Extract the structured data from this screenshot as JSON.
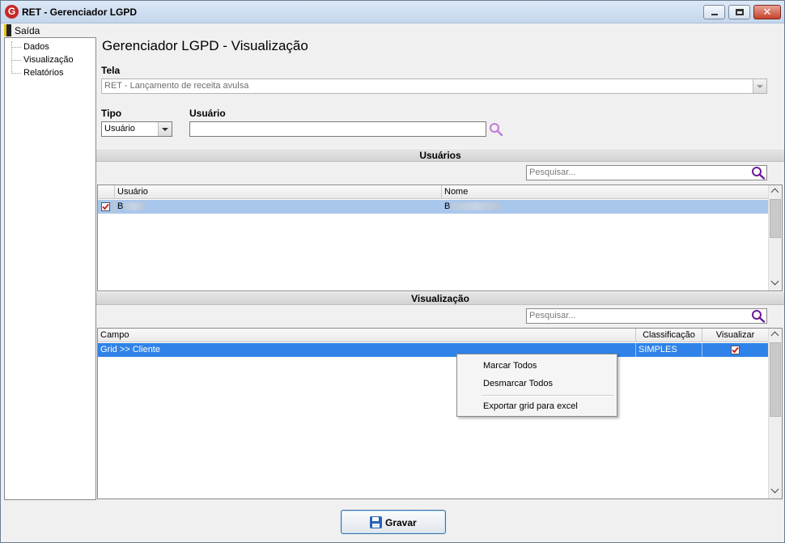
{
  "window": {
    "title": "RET - Gerenciador LGPD",
    "logo_letter": "G",
    "close_glyph": "✕"
  },
  "menubar": {
    "exit_label": "Saída"
  },
  "tree": {
    "items": [
      "Dados",
      "Visualização",
      "Relatórios"
    ]
  },
  "page": {
    "title": "Gerenciador LGPD - Visualização"
  },
  "tela": {
    "label": "Tela",
    "value": "RET - Lançamento de receita avulsa"
  },
  "tipo": {
    "label": "Tipo",
    "value": "Usuário"
  },
  "usuario": {
    "label": "Usuário",
    "value": ""
  },
  "usuarios_section": {
    "title": "Usuários",
    "search_placeholder": "Pesquisar...",
    "columns": [
      "Usuário",
      "Nome"
    ],
    "rows": [
      {
        "checked": true,
        "usuario": "B",
        "nome": "B"
      }
    ]
  },
  "visualizacao_section": {
    "title": "Visualização",
    "search_placeholder": "Pesquisar...",
    "columns": [
      "Campo",
      "Classificação",
      "Visualizar"
    ],
    "rows": [
      {
        "campo": "Grid >> Cliente",
        "classificacao": "SIMPLES",
        "visualizar": true
      }
    ]
  },
  "context_menu": {
    "items": [
      "Marcar Todos",
      "Desmarcar Todos",
      "Exportar grid para excel"
    ]
  },
  "footer": {
    "save_label": "Gravar"
  },
  "colors": {
    "selection": "#2f83e8",
    "titlebar": "#c4d6ec",
    "close_button": "#c7412b"
  }
}
